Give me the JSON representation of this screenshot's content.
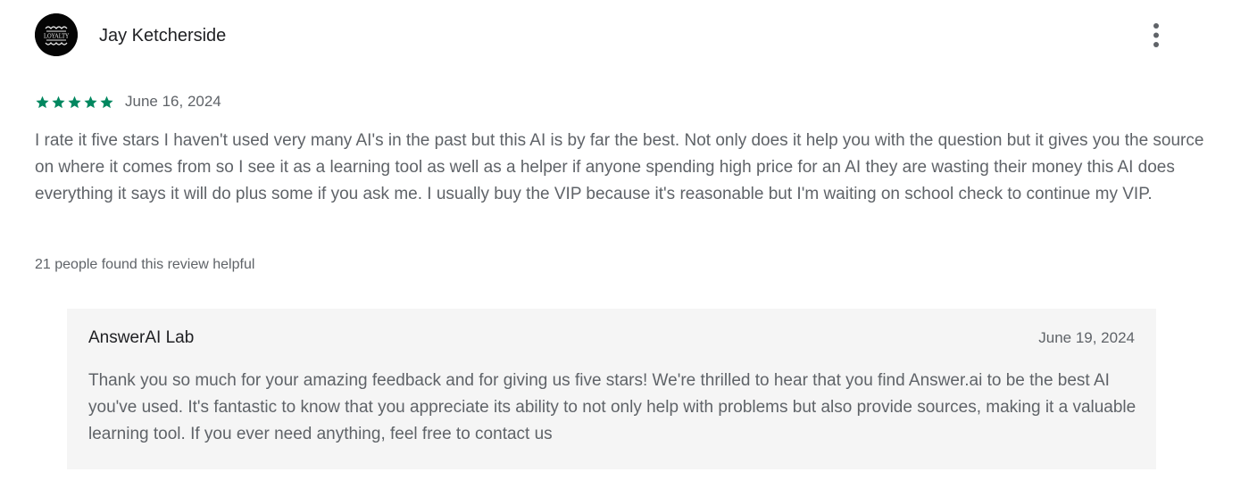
{
  "review": {
    "author": "Jay Ketcherside",
    "avatar_icon": "decorative-monogram-avatar",
    "more_icon": "more-vertical-icon",
    "rating": 5,
    "rating_max": 5,
    "star_color": "#01875f",
    "date": "June 16, 2024",
    "text": "I rate it five stars I haven't used very many AI's in the past but this AI is by far the best. Not only does it help you with the question but it gives you the source on where it comes from so I see it as a learning tool as well as a helper if anyone spending high price for an AI they are wasting their money this AI does everything it says it will do plus some if you ask me. I usually buy the VIP because it's reasonable but I'm waiting on school check to continue my VIP.",
    "helpful": "21 people found this review helpful"
  },
  "reply": {
    "author": "AnswerAI Lab",
    "date": "June 19, 2024",
    "text": "Thank you so much for your amazing feedback and for giving us five stars! We're thrilled to hear that you find Answer.ai to be the best AI you've used. It's fantastic to know that you appreciate its ability to not only help with problems but also provide sources, making it a valuable learning tool. If you ever need anything, feel free to contact us",
    "background_color": "#f5f5f5"
  }
}
